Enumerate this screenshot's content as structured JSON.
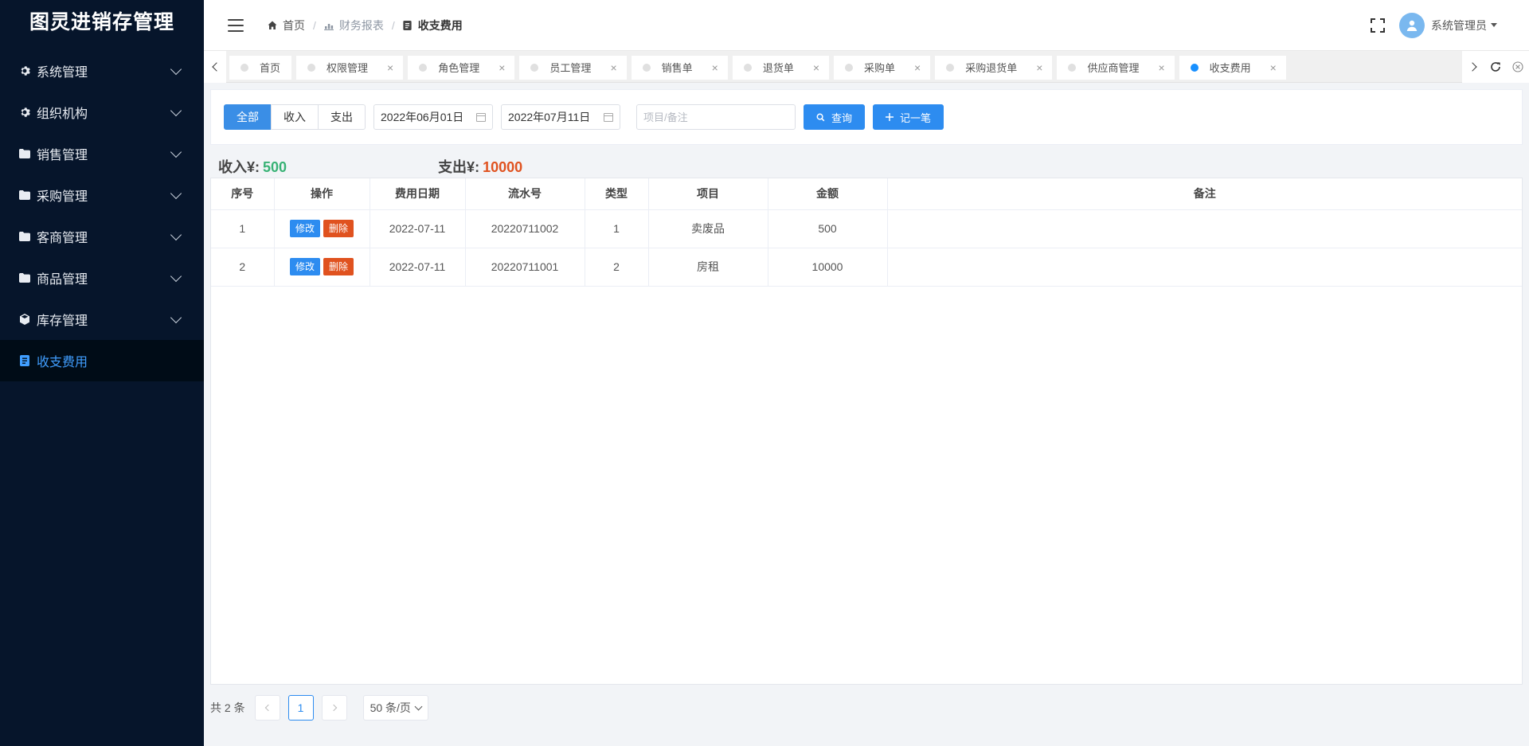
{
  "app": {
    "title": "图灵进销存管理"
  },
  "sidebar": {
    "items": [
      {
        "label": "系统管理",
        "icon": "gear-icon"
      },
      {
        "label": "组织机构",
        "icon": "gear-icon"
      },
      {
        "label": "销售管理",
        "icon": "folder-icon"
      },
      {
        "label": "采购管理",
        "icon": "folder-icon"
      },
      {
        "label": "客商管理",
        "icon": "folder-icon"
      },
      {
        "label": "商品管理",
        "icon": "folder-icon"
      },
      {
        "label": "库存管理",
        "icon": "cube-icon"
      },
      {
        "label": "收支费用",
        "icon": "document-icon"
      }
    ],
    "active_index": 7
  },
  "header": {
    "breadcrumb": [
      {
        "label": "首页",
        "icon": "home-icon"
      },
      {
        "label": "财务报表",
        "icon": "bar-chart-icon"
      },
      {
        "label": "收支费用",
        "icon": "document-icon"
      }
    ],
    "user": {
      "name": "系统管理员",
      "icon": "user-avatar-icon"
    }
  },
  "tabs": [
    {
      "label": "首页",
      "closable": false
    },
    {
      "label": "权限管理",
      "closable": true
    },
    {
      "label": "角色管理",
      "closable": true
    },
    {
      "label": "员工管理",
      "closable": true
    },
    {
      "label": "销售单",
      "closable": true
    },
    {
      "label": "退货单",
      "closable": true
    },
    {
      "label": "采购单",
      "closable": true
    },
    {
      "label": "采购退货单",
      "closable": true
    },
    {
      "label": "供应商管理",
      "closable": true
    },
    {
      "label": "收支费用",
      "closable": true,
      "active": true
    }
  ],
  "filter": {
    "segments": [
      {
        "label": "全部",
        "active": true
      },
      {
        "label": "收入",
        "active": false
      },
      {
        "label": "支出",
        "active": false
      }
    ],
    "start_date": "2022年06月01日",
    "end_date": "2022年07月11日",
    "search_placeholder": "项目/备注",
    "query_label": "查询",
    "add_label": "记一笔"
  },
  "totals": {
    "income_label": "收入¥:",
    "income_value": "500",
    "expense_label": "支出¥:",
    "expense_value": "10000"
  },
  "table": {
    "columns": [
      "序号",
      "操作",
      "费用日期",
      "流水号",
      "类型",
      "项目",
      "金额",
      "备注"
    ],
    "edit_label": "修改",
    "delete_label": "删除",
    "rows": [
      {
        "index": "1",
        "date": "2022-07-11",
        "serial": "20220711002",
        "type": "1",
        "item": "卖废品",
        "amount": "500",
        "note": ""
      },
      {
        "index": "2",
        "date": "2022-07-11",
        "serial": "20220711001",
        "type": "2",
        "item": "房租",
        "amount": "10000",
        "note": ""
      }
    ]
  },
  "pagination": {
    "total_text": "共 2 条",
    "current_page": "1",
    "page_size": "50 条/页"
  },
  "colors": {
    "sidebar_bg": "#06152b",
    "primary": "#2d8cf0",
    "danger": "#e0521f",
    "income": "#38b275",
    "expense": "#e0521f"
  }
}
